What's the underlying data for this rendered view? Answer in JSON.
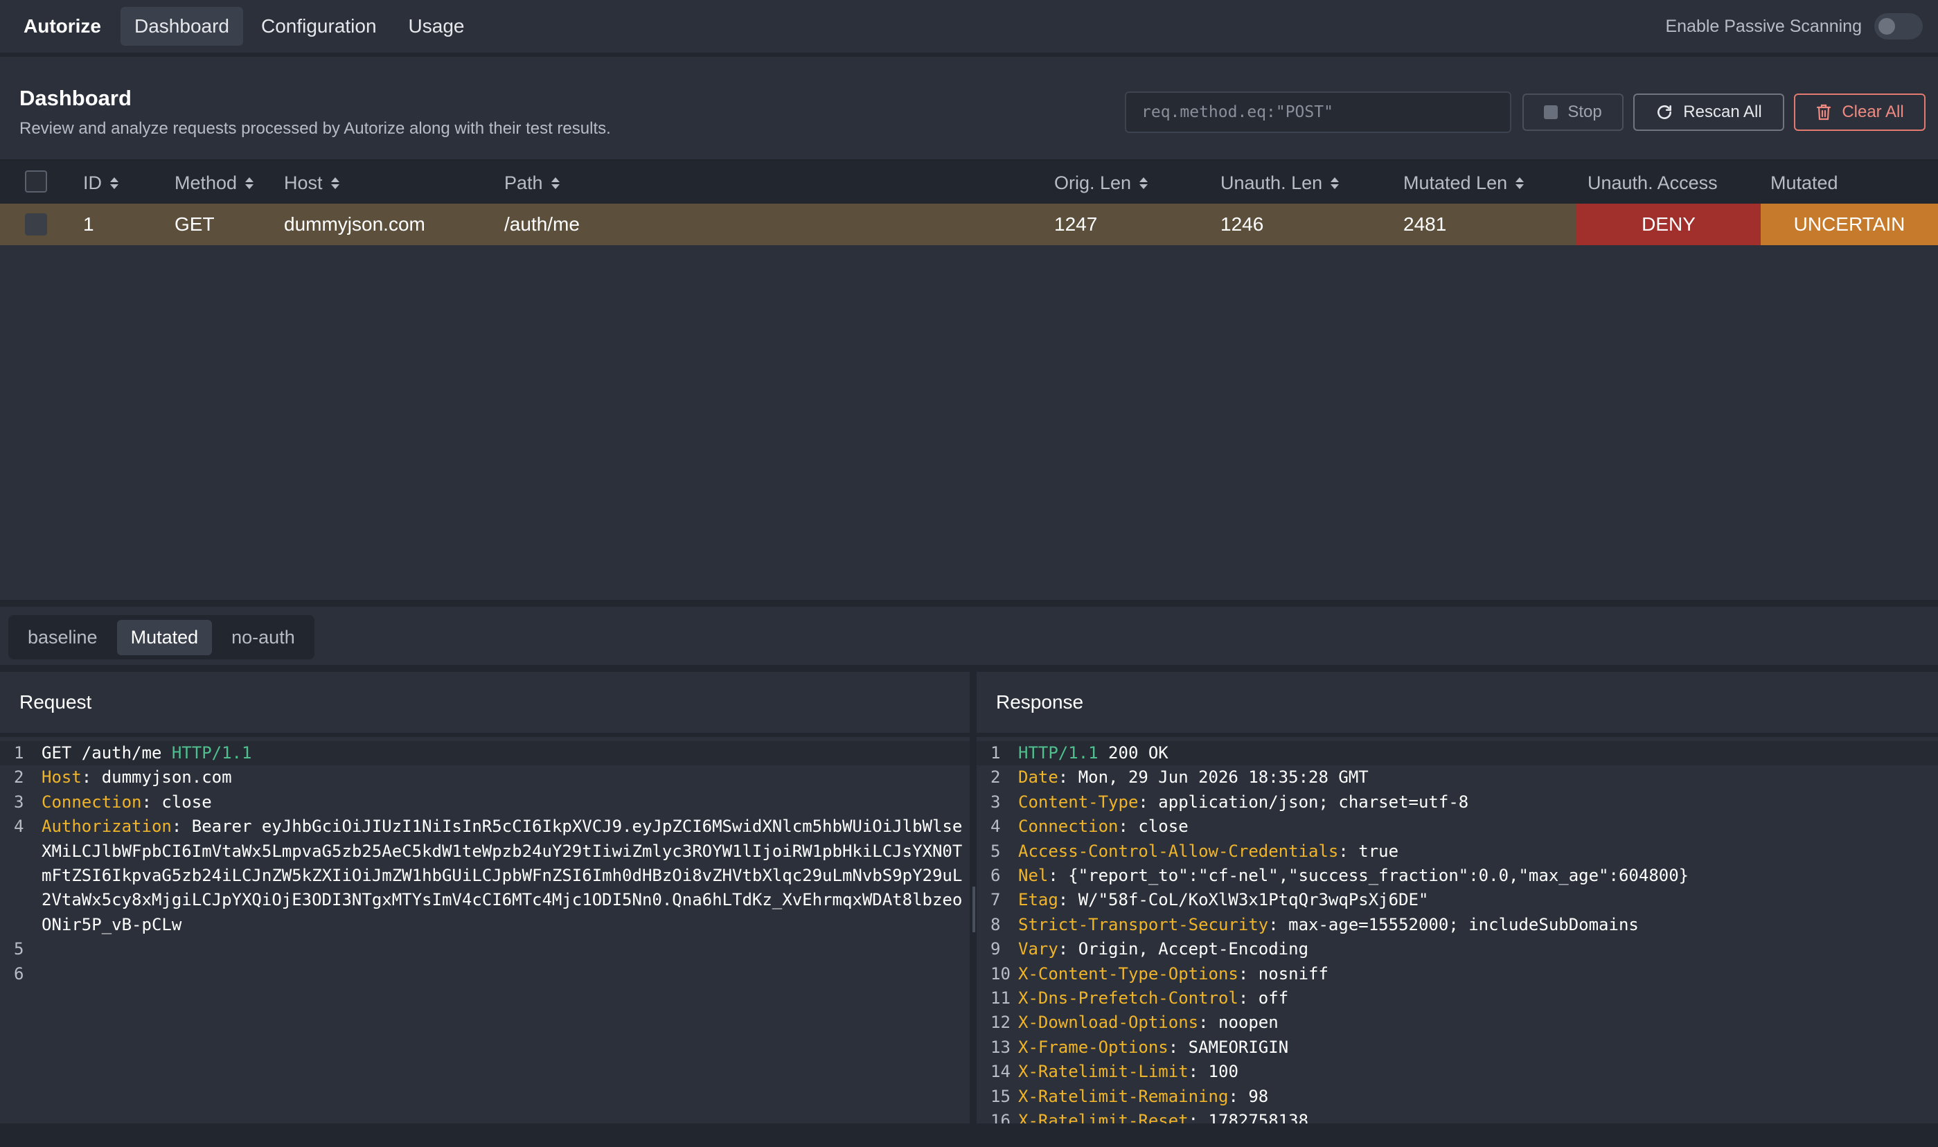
{
  "topbar": {
    "brand": "Autorize",
    "tabs": [
      "Dashboard",
      "Configuration",
      "Usage"
    ],
    "passive_label": "Enable Passive Scanning"
  },
  "dashboard": {
    "title": "Dashboard",
    "subtitle": "Review and analyze requests processed by Autorize along with their test results.",
    "filter_placeholder": "req.method.eq:\"POST\"",
    "stop_label": "Stop",
    "rescan_label": "Rescan All",
    "clear_label": "Clear All"
  },
  "table": {
    "headers": {
      "id": "ID",
      "method": "Method",
      "host": "Host",
      "path": "Path",
      "orig_len": "Orig. Len",
      "unauth_len": "Unauth. Len",
      "mutated_len": "Mutated Len",
      "unauth_access": "Unauth. Access",
      "mutated": "Mutated"
    },
    "rows": [
      {
        "id": "1",
        "method": "GET",
        "host": "dummyjson.com",
        "path": "/auth/me",
        "orig_len": "1247",
        "unauth_len": "1246",
        "mutated_len": "2481",
        "unauth_access": "DENY",
        "mutated": "UNCERTAIN"
      }
    ],
    "colors": {
      "row_highlight": "#5c4f3c",
      "deny": "#a1302c",
      "uncertain": "#c67a2b"
    }
  },
  "subtabs": [
    "baseline",
    "Mutated",
    "no-auth"
  ],
  "request": {
    "title": "Request",
    "lines": {
      "l1_method_path": "GET /auth/me ",
      "l1_proto": "HTTP/1.1",
      "l2_key": "Host",
      "l2_val": ": dummyjson.com",
      "l3_key": "Connection",
      "l3_val": ": close",
      "l4_key": "Authorization",
      "l4_val": ": Bearer eyJhbGciOiJIUzI1NiIsInR5cCI6IkpXVCJ9.eyJpZCI6MSwidXNlcm5hbWUiOiJlbWlseXMiLCJlbWFpbCI6ImVtaWx5LmpvaG5zb25AeC5kdW1teWpzb24uY29tIiwiZmlyc3ROYW1lIjoiRW1pbHkiLCJsYXN0TmFtZSI6IkpvaG5zb24iLCJnZW5kZXIiOiJmZW1hbGUiLCJpbWFnZSI6Imh0dHBzOi8vZHVtbXlqc29uLmNvbS9pY29uL2VtaWx5cy8xMjgiLCJpYXQiOjE3ODI3NTgxMTYsImV4cCI6MTc4Mjc1ODI5Nn0.Qna6hLTdKz_XvEhrmqxWDAt8lbzeoONir5P_vB-pCLw"
    }
  },
  "response": {
    "title": "Response",
    "status_proto": "HTTP/1.1",
    "status_code": " 200 OK",
    "headers": [
      {
        "k": "Date",
        "v": ": Mon, 29 Jun 2026 18:35:28 GMT"
      },
      {
        "k": "Content-Type",
        "v": ": application/json; charset=utf-8"
      },
      {
        "k": "Connection",
        "v": ": close"
      },
      {
        "k": "Access-Control-Allow-Credentials",
        "v": ": true"
      },
      {
        "k": "Nel",
        "v": ": {\"report_to\":\"cf-nel\",\"success_fraction\":0.0,\"max_age\":604800}"
      },
      {
        "k": "Etag",
        "v": ": W/\"58f-CoL/KoXlW3x1PtqQr3wqPsXj6DE\""
      },
      {
        "k": "Strict-Transport-Security",
        "v": ": max-age=15552000; includeSubDomains"
      },
      {
        "k": "Vary",
        "v": ": Origin, Accept-Encoding"
      },
      {
        "k": "X-Content-Type-Options",
        "v": ": nosniff"
      },
      {
        "k": "X-Dns-Prefetch-Control",
        "v": ": off"
      },
      {
        "k": "X-Download-Options",
        "v": ": noopen"
      },
      {
        "k": "X-Frame-Options",
        "v": ": SAMEORIGIN"
      },
      {
        "k": "X-Ratelimit-Limit",
        "v": ": 100"
      },
      {
        "k": "X-Ratelimit-Remaining",
        "v": ": 98"
      },
      {
        "k": "X-Ratelimit-Reset",
        "v": ": 1782758138"
      }
    ]
  },
  "line_numbers": {
    "req": [
      "1",
      "2",
      "3",
      "4",
      "5",
      "6"
    ],
    "res": [
      "1",
      "2",
      "3",
      "4",
      "5",
      "6",
      "7",
      "8",
      "9",
      "10",
      "11",
      "12",
      "13",
      "14",
      "15",
      "16"
    ]
  }
}
